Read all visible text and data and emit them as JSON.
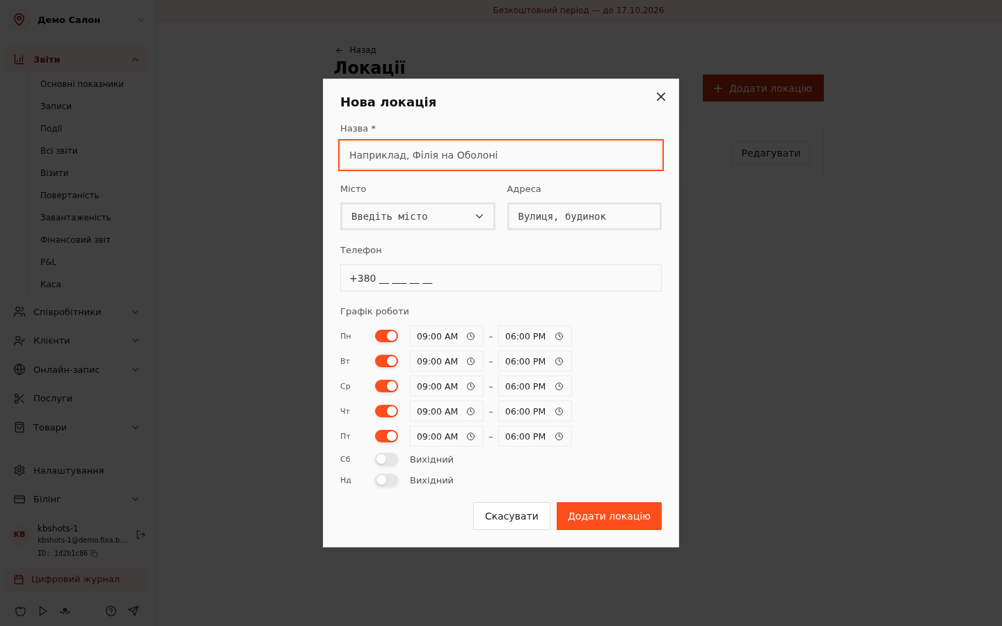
{
  "sidebar": {
    "salon": {
      "name": "Демо Салон"
    },
    "menu": [
      {
        "kind": "group",
        "label": "Звіти",
        "selected": true,
        "expanded": true,
        "children": [
          {
            "label": "Основні показники"
          },
          {
            "label": "Записи"
          },
          {
            "label": "Події"
          },
          {
            "label": "Всі звіти"
          },
          {
            "label": "Візити"
          },
          {
            "label": "Повертаність"
          },
          {
            "label": "Завантаженість"
          },
          {
            "label": "Фінансовий звіт"
          },
          {
            "label": "P&L"
          },
          {
            "label": "Каса"
          }
        ]
      },
      {
        "kind": "group",
        "label": "Співробітники",
        "selected": false,
        "expanded": false
      },
      {
        "kind": "group",
        "label": "Клієнти",
        "selected": false,
        "expanded": false
      },
      {
        "kind": "group",
        "label": "Онлайн-запис",
        "selected": false,
        "expanded": false
      },
      {
        "kind": "link",
        "label": "Послуги",
        "selected": false
      },
      {
        "kind": "group",
        "label": "Товари",
        "selected": false,
        "expanded": false
      }
    ],
    "menu_secondary": [
      {
        "kind": "link",
        "label": "Налаштування",
        "selected": false
      },
      {
        "kind": "group",
        "label": "Білінг",
        "selected": false,
        "expanded": false
      }
    ],
    "user": {
      "initials": "KB",
      "name": "kbshots-1",
      "email": "kbshots-1@demo.fixa.b…",
      "id": "ID: 1d2b1c86"
    },
    "journal_button": {
      "label": "Цифровий журнал"
    }
  },
  "trial_banner": {
    "text": "Безкоштовний період — до 17.10.2026"
  },
  "page": {
    "back_link": "Назад",
    "title": "Локації",
    "add_button": "Додати локацію",
    "card": {
      "edit_button": "Редагувати"
    }
  },
  "modal": {
    "title": "Нова локація",
    "name_field": {
      "label": "Назва *",
      "placeholder": "Наприклад, Філія на Оболоні",
      "focused": true
    },
    "city_field": {
      "label": "Місто",
      "placeholder": "Введіть місто"
    },
    "address_field": {
      "label": "Адреса",
      "placeholder": "Вулиця, будинок"
    },
    "phone_field": {
      "label": "Телефон",
      "placeholder": "+380 __ ___ __ __"
    },
    "schedule": {
      "label": "Графік роботи",
      "days": [
        {
          "day": "Пн",
          "on": true,
          "from": "09:00 AM",
          "separator": "–",
          "to": "06:00 PM"
        },
        {
          "day": "Вт",
          "on": true,
          "from": "09:00 AM",
          "separator": "–",
          "to": "06:00 PM"
        },
        {
          "day": "Ср",
          "on": true,
          "from": "09:00 AM",
          "separator": "–",
          "to": "06:00 PM"
        },
        {
          "day": "Чт",
          "on": true,
          "from": "09:00 AM",
          "separator": "–",
          "to": "06:00 PM"
        },
        {
          "day": "Пт",
          "on": true,
          "from": "09:00 AM",
          "separator": "–",
          "to": "06:00 PM"
        },
        {
          "day": "Сб",
          "on": false,
          "off_label": "Вихідний"
        },
        {
          "day": "Нд",
          "on": false,
          "off_label": "Вихідний"
        }
      ]
    },
    "buttons": {
      "cancel": "Скасувати",
      "submit": "Додати локацію"
    }
  }
}
